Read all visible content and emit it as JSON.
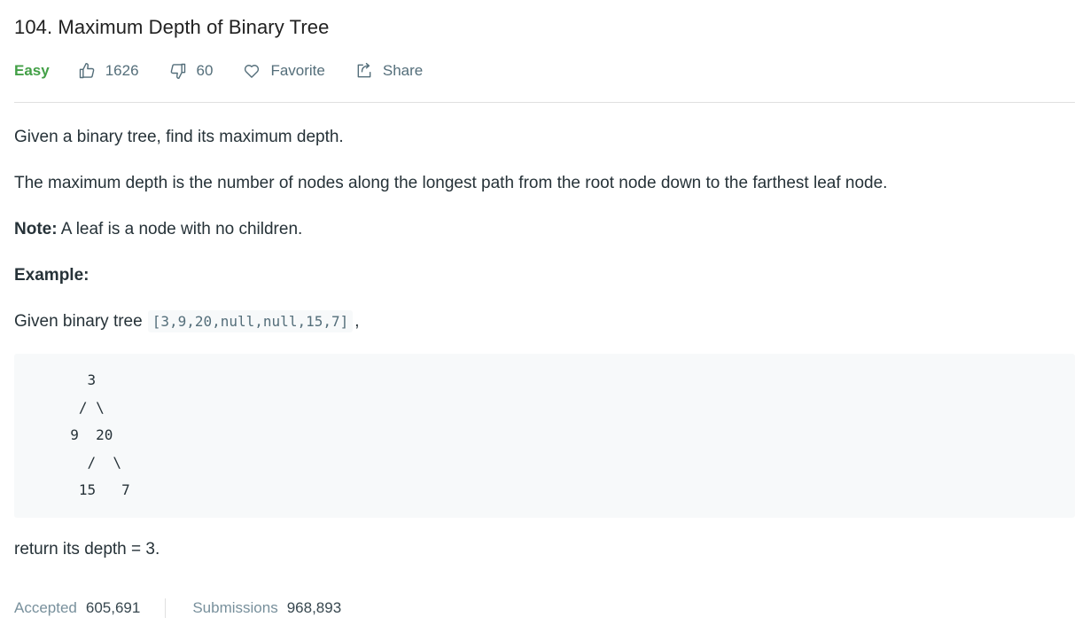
{
  "problem": {
    "title": "104. Maximum Depth of Binary Tree",
    "difficulty": "Easy",
    "likes": "1626",
    "dislikes": "60",
    "favorite_label": "Favorite",
    "share_label": "Share"
  },
  "description": {
    "para1": "Given a binary tree, find its maximum depth.",
    "para2": "The maximum depth is the number of nodes along the longest path from the root node down to the farthest leaf node.",
    "note_label": "Note:",
    "note_text": " A leaf is a node with no children.",
    "example_label": "Example:",
    "given_text": "Given binary tree",
    "given_code": "[3,9,20,null,null,15,7]",
    "given_suffix": ",",
    "tree_ascii": "    3\n   / \\\n  9  20\n    /  \\\n   15   7",
    "return_text": "return its depth = 3."
  },
  "stats": {
    "accepted_label": "Accepted",
    "accepted_value": "605,691",
    "submissions_label": "Submissions",
    "submissions_value": "968,893"
  },
  "colors": {
    "easy": "#43a047",
    "muted": "#546e7a",
    "code_bg": "#f7f9fa"
  }
}
